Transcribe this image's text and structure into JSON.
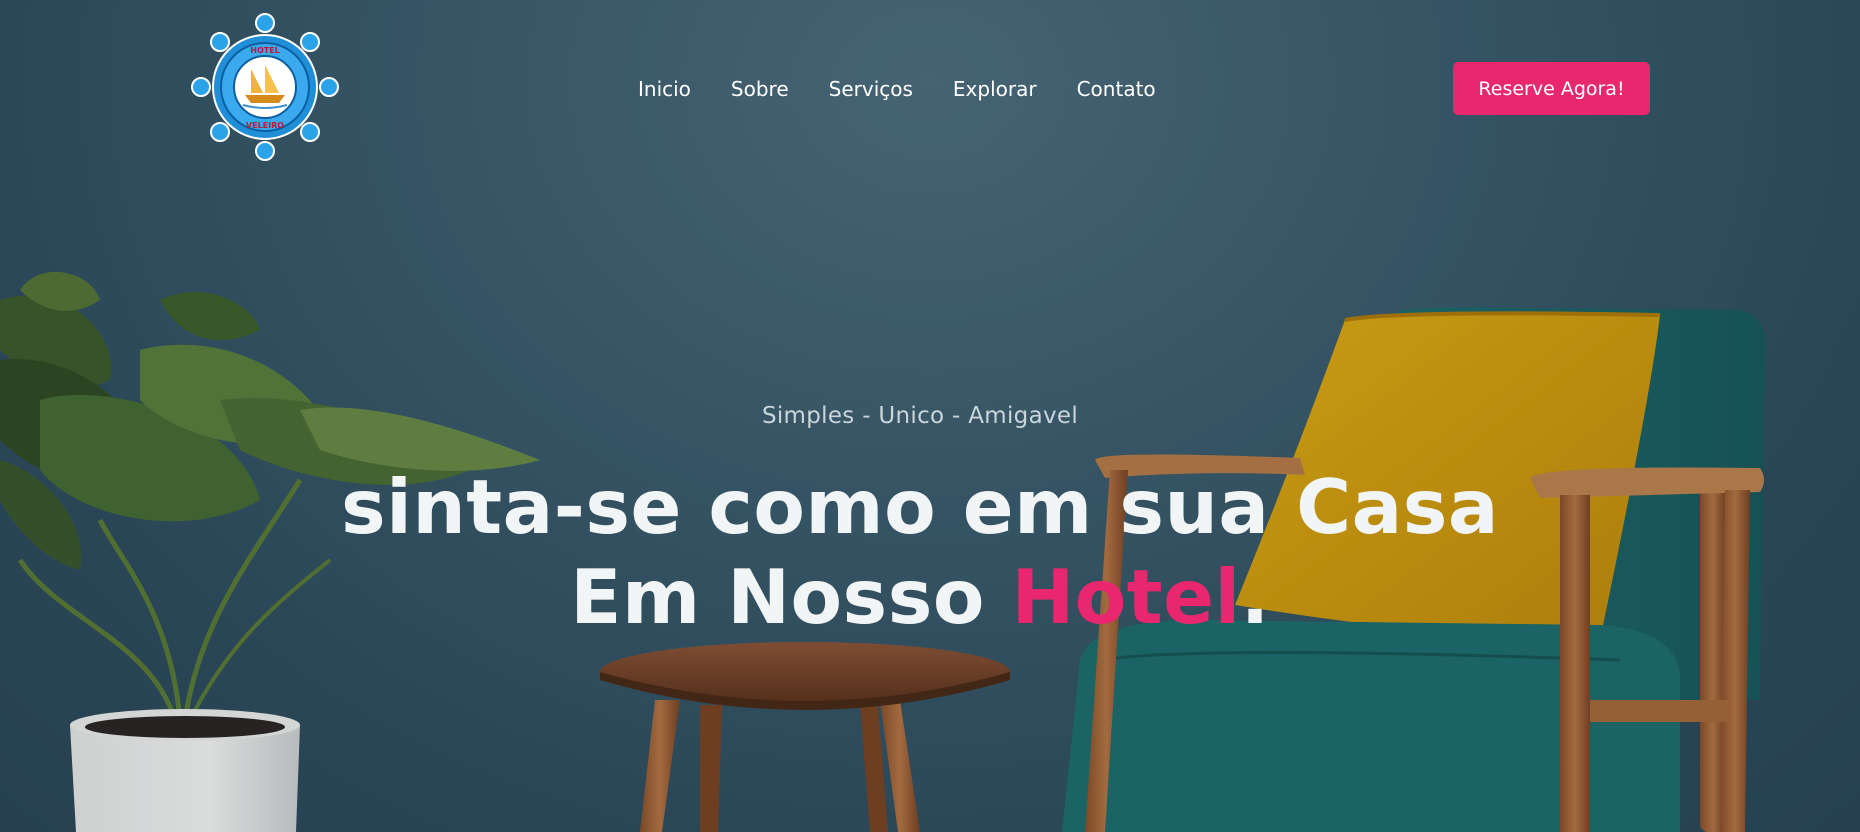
{
  "logo": {
    "top_text": "HOTEL",
    "bottom_text": "VELEIRO"
  },
  "nav": {
    "items": [
      "Inicio",
      "Sobre",
      "Serviços",
      "Explorar",
      "Contato"
    ]
  },
  "cta": {
    "label": "Reserve Agora!"
  },
  "hero": {
    "tagline": "Simples - Unico - Amigavel",
    "line1": "sinta-se como em sua Casa",
    "line2_prefix": "Em Nosso ",
    "line2_accent": "Hotel",
    "line2_suffix": "."
  },
  "colors": {
    "accent": "#e8276e",
    "background": "#3b5b6b",
    "cushion": "#d9a108",
    "chair_fabric": "#1d6b6c"
  },
  "icons": [
    "ship-wheel-logo"
  ]
}
